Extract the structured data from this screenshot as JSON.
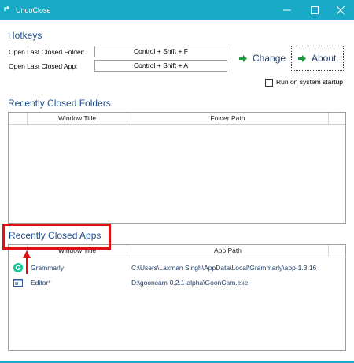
{
  "window": {
    "title": "UndoClose"
  },
  "hotkeys": {
    "section_title": "Hotkeys",
    "folder_label": "Open Last Closed Folder:",
    "folder_value": "Control + Shift + F",
    "app_label": "Open Last Closed App:",
    "app_value": "Control + Shift + A",
    "change_label": "Change",
    "about_label": "About",
    "startup_label": "Run on system startup",
    "startup_checked": false
  },
  "folders": {
    "section_title": "Recently Closed Folders",
    "columns": [
      "",
      "Window Title",
      "Folder Path"
    ],
    "rows": []
  },
  "apps": {
    "section_title": "Recently Closed Apps",
    "columns": [
      "",
      "Window Title",
      "App Path"
    ],
    "rows": [
      {
        "icon": "grammarly-icon",
        "title": "Grammarly",
        "path": "C:\\Users\\Laxman Singh\\AppData\\Local\\Grammarly\\app-1.3.16"
      },
      {
        "icon": "window-app-icon",
        "title": "Editor*",
        "path": "D:\\gooncam-0.2.1-alpha\\GoonCam.exe"
      }
    ]
  },
  "colors": {
    "titlebar": "#17a9c6",
    "section_title": "#1f4e8c",
    "highlight": "#e01010",
    "grammarly": "#15c39a"
  }
}
